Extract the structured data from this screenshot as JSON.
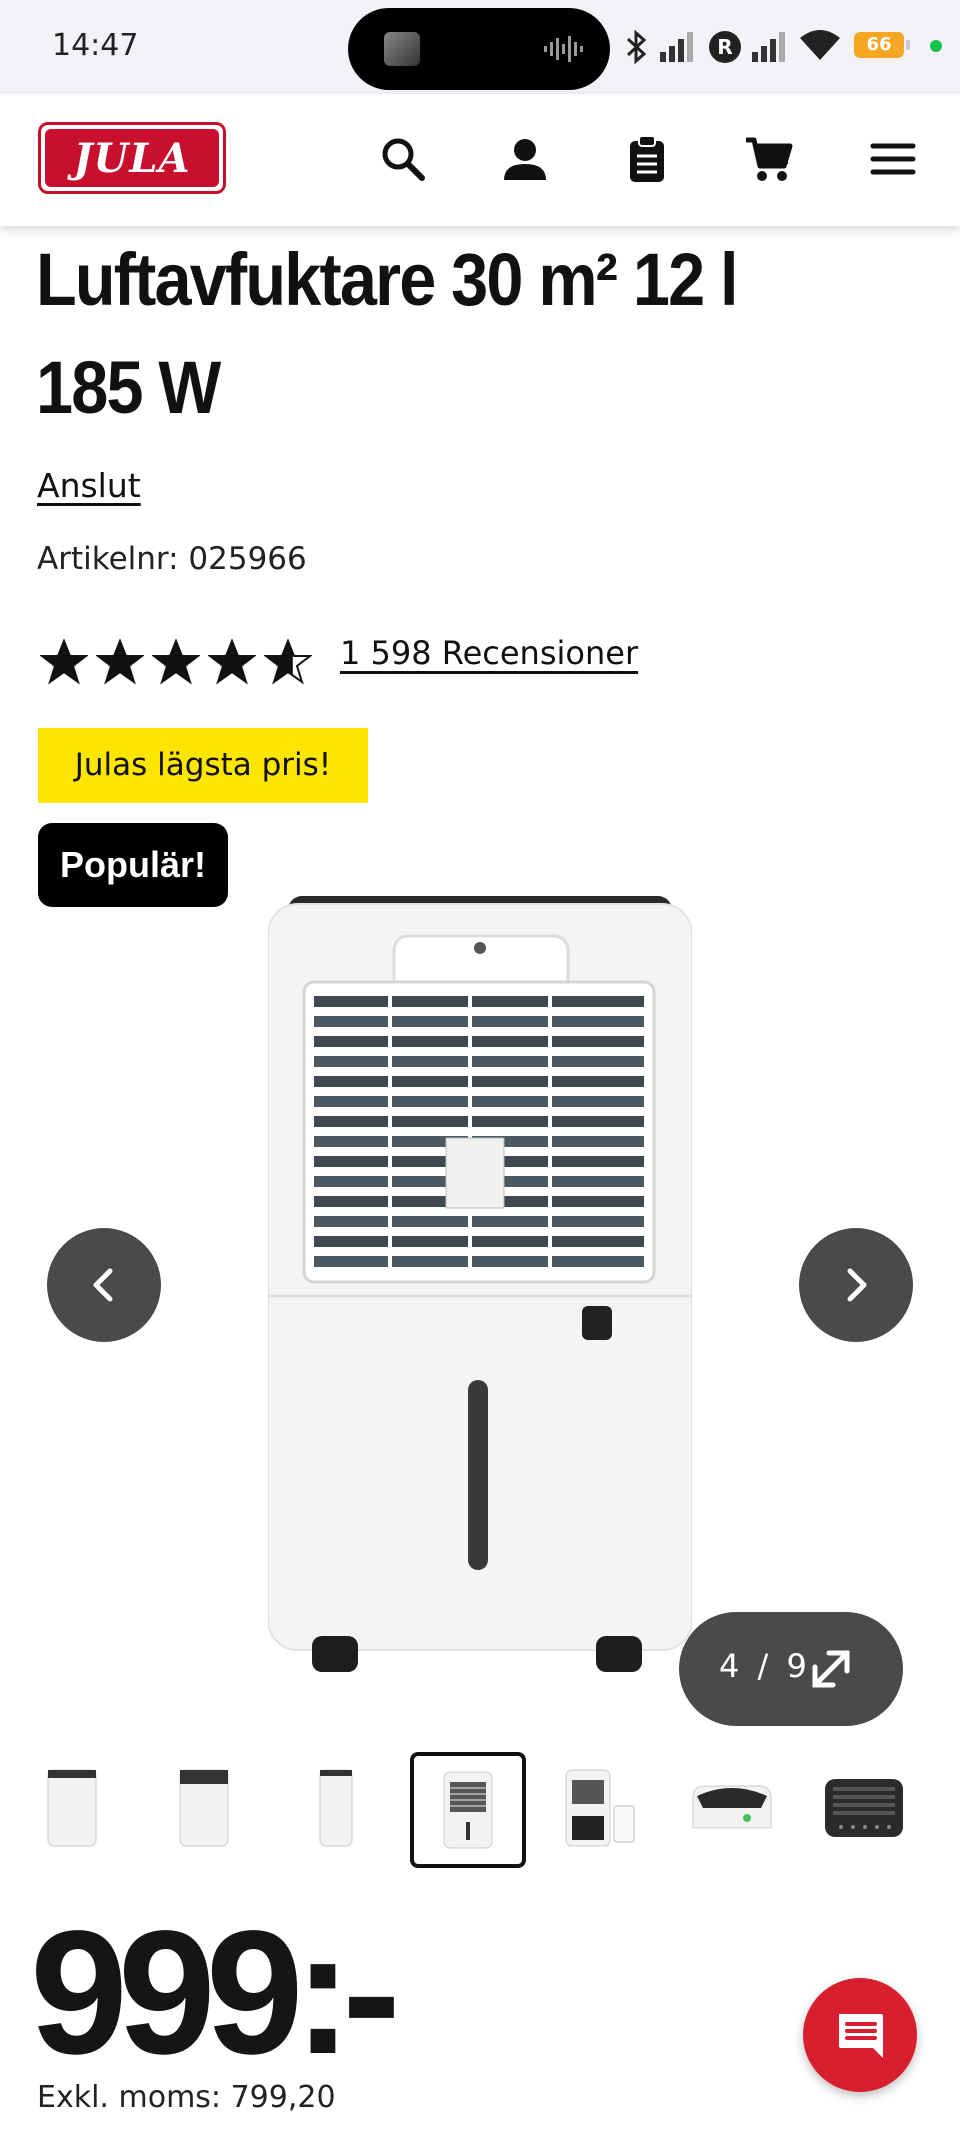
{
  "status_bar": {
    "time": "14:47",
    "battery": "66",
    "icons": [
      "bluetooth-icon",
      "signal-icon",
      "r-badge-icon",
      "signal-icon",
      "wifi-icon",
      "battery-icon",
      "camera-indicator-dot"
    ]
  },
  "header": {
    "logo_text": "JULA",
    "icons": [
      "search-icon",
      "account-icon",
      "clipboard-icon",
      "cart-icon",
      "menu-icon"
    ],
    "brand_color": "#c8102e"
  },
  "product": {
    "title": "Luftavfuktare 30 m² 12 l 185 W",
    "brand_link": "Anslut",
    "article_label": "Artikelnr:",
    "article_number": "025966",
    "rating": 4.6,
    "rating_max": 5,
    "reviews_link": "1 598 Recensioner",
    "badge_lowest_price": "Julas lägsta pris!",
    "badge_popular": "Populär!",
    "image_alt": "dehumidifier-image",
    "gallery_position": "4 / 9",
    "gallery_current": 4,
    "gallery_total": 9,
    "thumbnails": [
      "thumb-front",
      "thumb-front-dark",
      "thumb-side",
      "thumb-grille",
      "thumb-open-tank",
      "thumb-top-panel",
      "thumb-control-panel"
    ],
    "active_thumbnail": 4,
    "price": "999:-",
    "price_ex_vat": "Exkl. moms: 799,20"
  },
  "colors": {
    "badge_yellow": "#ffe600",
    "badge_black": "#000000",
    "overlay_button": "#4a4a4a",
    "chat_button": "#d71f30"
  }
}
